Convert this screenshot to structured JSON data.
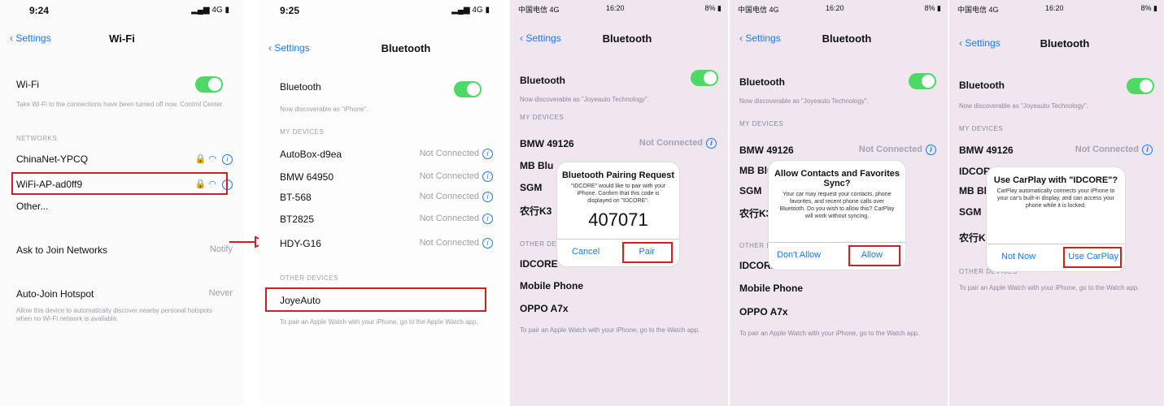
{
  "panel1": {
    "status": {
      "time": "9:24",
      "network": "4G"
    },
    "nav": {
      "back": "Settings",
      "title": "Wi-Fi"
    },
    "wifi_label": "Wi-Fi",
    "wifi_note": "Take Wi-Fi to the connections have been turned off now. Control Center.",
    "networks_header": "NETWORKS",
    "networks": [
      "ChinaNet-YPCQ",
      "WiFi-AP-ad0ff9",
      "Other..."
    ],
    "ask_join": {
      "label": "Ask to Join Networks",
      "value": "Notify"
    },
    "auto_join": {
      "label": "Auto-Join Hotspot",
      "value": "Never"
    },
    "auto_join_note": "Allow this device to automatically discover nearby personal hotspots when no Wi-Fi network is available."
  },
  "panel2": {
    "status": {
      "time": "9:25",
      "network": "4G"
    },
    "nav": {
      "back": "Settings",
      "title": "Bluetooth"
    },
    "bt_label": "Bluetooth",
    "discoverable": "Now discoverable as \"iPhone\".",
    "my_devices_header": "MY DEVICES",
    "devices": [
      {
        "name": "AutoBox-d9ea",
        "status": "Not Connected"
      },
      {
        "name": "BMW 64950",
        "status": "Not Connected"
      },
      {
        "name": "BT-568",
        "status": "Not Connected"
      },
      {
        "name": "BT2825",
        "status": "Not Connected"
      },
      {
        "name": "HDY-G16",
        "status": "Not Connected"
      }
    ],
    "other_devices_header": "OTHER DEVICES",
    "other_device": "JoyeAuto",
    "watch_note": "To pair an Apple Watch with your iPhone, go to the Apple Watch app."
  },
  "shared_pink": {
    "status": {
      "carrier": "中国电信 4G",
      "time": "16:20",
      "battery": "8%"
    },
    "nav": {
      "back": "Settings",
      "title": "Bluetooth"
    },
    "bt_label": "Bluetooth",
    "discoverable": "Now discoverable as \"Joyeauto Technology\".",
    "my_devices_header": "MY DEVICES",
    "other_devices_header": "OTHER DEVICES",
    "not_connected": "Not Connected",
    "watch_note": "To pair an Apple Watch with your iPhone, go to the Watch app."
  },
  "panel3": {
    "devices": [
      "BMW 49126",
      "MB Blu",
      "SGM",
      "农行K3"
    ],
    "others": [
      "IDCORE",
      "Mobile Phone",
      "OPPO A7x"
    ],
    "dialog": {
      "title": "Bluetooth Pairing Request",
      "body": "\"IDCORE\" would like to pair with your iPhone. Confirm that this code is displayed on \"IDCORE\".",
      "code": "407071",
      "cancel": "Cancel",
      "pair": "Pair"
    }
  },
  "panel4": {
    "devices": [
      "BMW 49126",
      "MB Blu",
      "SGM",
      "农行K3"
    ],
    "others": [
      "IDCORE",
      "Mobile Phone",
      "OPPO A7x"
    ],
    "dialog": {
      "title": "Allow Contacts and Favorites Sync?",
      "body": "Your car may request your contacts, phone favorites, and recent phone calls over Bluetooth. Do you wish to allow this? CarPlay will work without syncing.",
      "deny": "Don't Allow",
      "allow": "Allow"
    }
  },
  "panel5": {
    "devices": [
      "BMW 49126",
      "IDCORE",
      "MB Blu",
      "SGM",
      "农行K3"
    ],
    "dialog": {
      "title": "Use CarPlay with \"IDCORE\"?",
      "body": "CarPlay automatically connects your iPhone to your car's built-in display, and can access your phone while it is locked.",
      "not_now": "Not Now",
      "use": "Use CarPlay"
    },
    "watch_note": "To pair an Apple Watch with your iPhone, go to the Watch app."
  }
}
